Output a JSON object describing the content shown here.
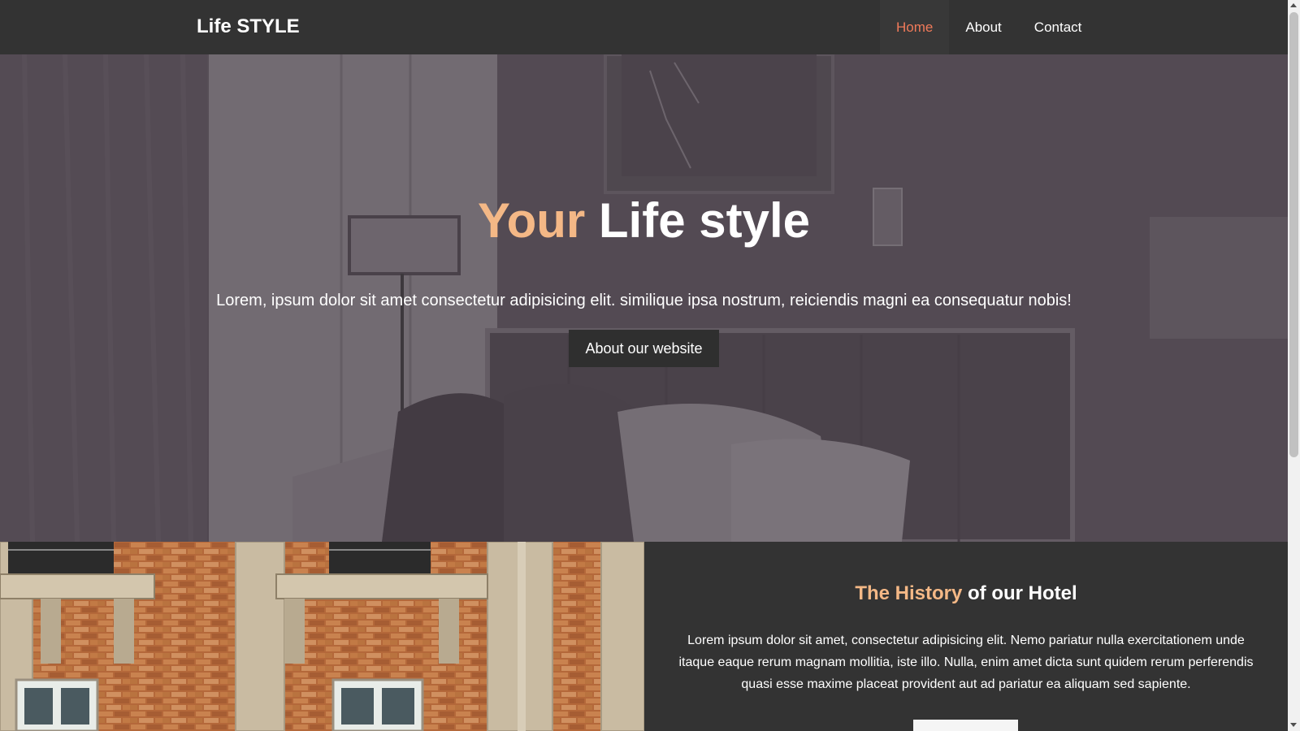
{
  "navbar": {
    "brand": "Life STYLE",
    "items": [
      {
        "label": "Home",
        "active": true
      },
      {
        "label": "About",
        "active": false
      },
      {
        "label": "Contact",
        "active": false
      }
    ],
    "accent_color": "#f07a5a"
  },
  "hero": {
    "title_accent": "Your",
    "title_rest": " Life style",
    "subtitle": "Lorem, ipsum dolor sit amet consectetur adipisicing elit. similique ipsa nostrum, reiciendis magni ea consequatur nobis!",
    "button_label": "About our website",
    "title_accent_color": "#f4b886"
  },
  "history": {
    "title_accent": "The History",
    "title_rest": " of our Hotel",
    "text": "Lorem ipsum dolor sit amet, consectetur adipisicing elit. Nemo pariatur nulla exercitationem unde itaque eaque rerum magnam mollitia, iste illo. Nulla, enim amet dicta sunt quidem rerum perferendis quasi esse maxime placeat provident aut ad pariatur ea aliquam sed sapiente."
  }
}
